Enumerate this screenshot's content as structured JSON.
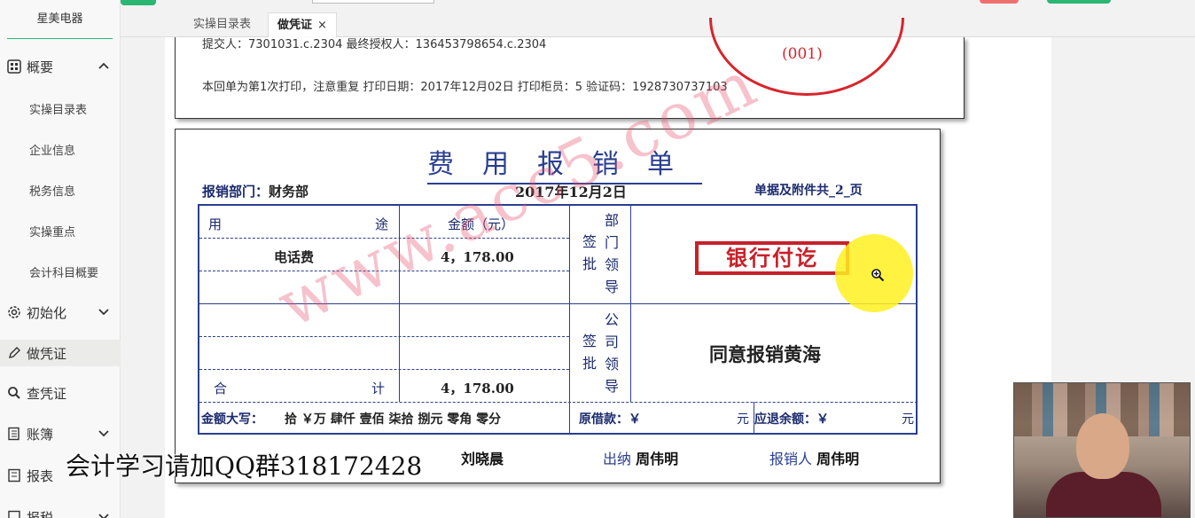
{
  "sidebar": {
    "brand": "星美电器",
    "groups": [
      {
        "label": "概要",
        "icon": "grid-icon",
        "chevron": "chevron-up-icon"
      },
      {
        "label": "初始化",
        "icon": "gear-icon",
        "chevron": "chevron-down-icon"
      },
      {
        "label": "做凭证",
        "icon": "pen-icon"
      },
      {
        "label": "查凭证",
        "icon": "search-icon"
      },
      {
        "label": "账簿",
        "icon": "book-icon",
        "chevron": "chevron-down-icon"
      },
      {
        "label": "报表",
        "icon": "report-icon"
      },
      {
        "label": "报税",
        "icon": "tax-icon",
        "chevron": "chevron-down-icon"
      }
    ],
    "sub_items": [
      "实操目录表",
      "企业信息",
      "税务信息",
      "实操重点",
      "会计科目概要"
    ]
  },
  "tabs": [
    {
      "label": "实操目录表"
    },
    {
      "label": "做凭证",
      "close": "×"
    }
  ],
  "receipt": {
    "line1": "提交人：7301031.c.2304 最终授权人：136453798654.c.2304",
    "line2": "本回单为第1次打印，注意重复    打印日期：2017年12月02日    打印柜员：5    验证码：192873",
    "line2_tail": "0737103",
    "seal_number": "(001)"
  },
  "form": {
    "title": "费用报销单",
    "dept_label": "报销部门：",
    "dept_value": "财务部",
    "date": "2017年12月2日",
    "attachments": "单据及附件共_2_页",
    "col_purpose_a": "用",
    "col_purpose_b": "途",
    "col_amount": "金额（元）",
    "dept_sign_a": "签\n批",
    "dept_sign_b": "部\n门\n领\n导",
    "co_sign_a": "签\n批",
    "co_sign_b": "公\n司\n领\n导",
    "rows": [
      {
        "purpose": "电话费",
        "amount": "4，178.00"
      }
    ],
    "total_a": "合",
    "total_b": "计",
    "total_amount": "4，178.00",
    "approval_text": "同意报销黄海",
    "capital_label": "金额大写：",
    "capital_value": "拾 ￥万 肆仟 壹佰 柒拾 捌元 零角 零分",
    "advance_label": "原借款：￥",
    "advance_unit": "元",
    "refund_label": "应退余额：￥",
    "refund_unit": "元",
    "signer1": "刘晓晨",
    "cashier_label": "出纳",
    "cashier_name": "周伟明",
    "claimant_label": "报销人",
    "claimant_name": "周伟明",
    "stamp_text": "银行付讫"
  },
  "watermark": "www.acc5.com",
  "banner": "会计学习请加QQ群318172428",
  "colors": {
    "accent": "#2bb673",
    "form_blue": "#2a3e90",
    "stamp_red": "#c9202a"
  }
}
